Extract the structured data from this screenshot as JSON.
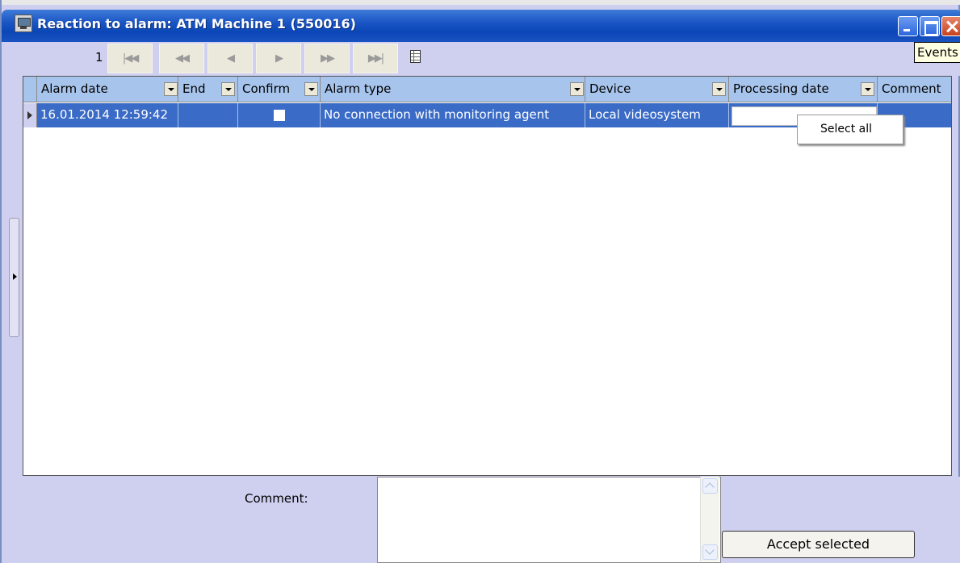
{
  "window": {
    "title": "Reaction to alarm: ATM Machine 1 (550016)",
    "tooltip": "Events"
  },
  "navbar": {
    "page": "1",
    "buttons": [
      {
        "name": "first-page-button",
        "glyph": "|◀◀"
      },
      {
        "name": "prev-page-set-button",
        "glyph": "◀◀"
      },
      {
        "name": "prev-page-button",
        "glyph": "◀"
      },
      {
        "name": "next-page-button",
        "glyph": "▶"
      },
      {
        "name": "next-page-set-button",
        "glyph": "▶▶"
      },
      {
        "name": "last-page-button",
        "glyph": "▶▶|"
      }
    ]
  },
  "table": {
    "columns": [
      "Alarm date",
      "End",
      "Confirm",
      "Alarm type",
      "Device",
      "Processing date",
      "Comment"
    ],
    "rows": [
      {
        "alarm_date": "16.01.2014 12:59:42",
        "end": "",
        "confirm": false,
        "alarm_type": "No connection with monitoring agent",
        "device": "Local videosystem",
        "processing_date": "",
        "comment": ""
      }
    ]
  },
  "context_menu": {
    "select_all": "Select all"
  },
  "bottom": {
    "comment_label": "Comment:",
    "comment_value": "",
    "accept_button": "Accept selected"
  }
}
